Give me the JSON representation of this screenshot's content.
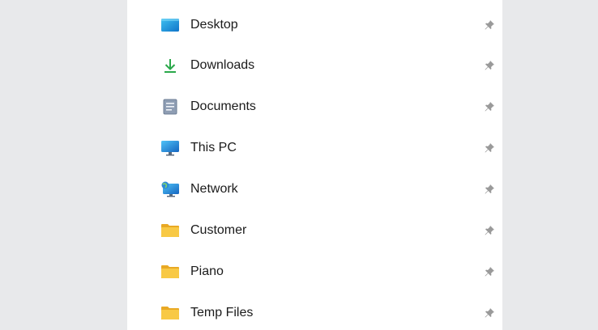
{
  "quick_access": {
    "items": [
      {
        "label": "Desktop",
        "icon": "desktop-icon",
        "pinned": true
      },
      {
        "label": "Downloads",
        "icon": "downloads-icon",
        "pinned": true
      },
      {
        "label": "Documents",
        "icon": "documents-icon",
        "pinned": true
      },
      {
        "label": "This PC",
        "icon": "this-pc-icon",
        "pinned": true
      },
      {
        "label": "Network",
        "icon": "network-icon",
        "pinned": true
      },
      {
        "label": "Customer",
        "icon": "folder-icon",
        "pinned": true
      },
      {
        "label": "Piano",
        "icon": "folder-icon",
        "pinned": true
      },
      {
        "label": "Temp Files",
        "icon": "folder-icon",
        "pinned": true
      }
    ]
  },
  "colors": {
    "background": "#e8e9eb",
    "panel": "#ffffff",
    "folder_yellow": "#f8c945",
    "download_green": "#2aa84a",
    "pin_gray": "#9a9a9a"
  }
}
